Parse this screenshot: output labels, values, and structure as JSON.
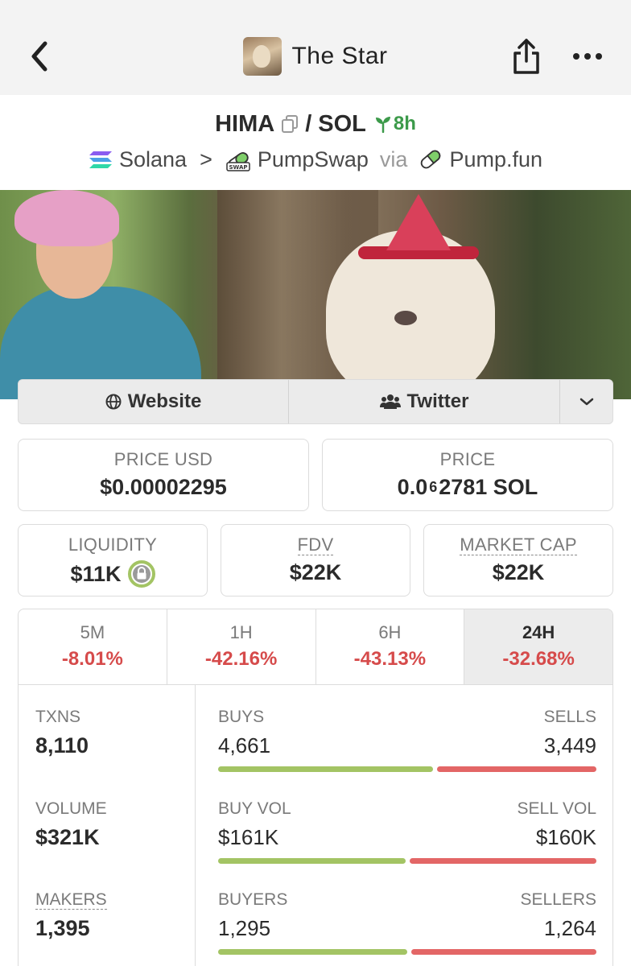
{
  "nav": {
    "title": "The Star",
    "icons": [
      "chevron-left-icon",
      "share-icon",
      "more-icon"
    ]
  },
  "pair": {
    "base": "HIMA",
    "separator": "/",
    "quote": "SOL",
    "age": "8h"
  },
  "route": {
    "chain": "Solana",
    "arrow": ">",
    "dex": "PumpSwap",
    "via": "via",
    "launchpad": "Pump.fun"
  },
  "links": {
    "website": "Website",
    "twitter": "Twitter"
  },
  "prices": {
    "usd_label": "PRICE USD",
    "usd_value": "$0.00002295",
    "native_label": "PRICE",
    "native_prefix": "0.0",
    "native_zeros": "6",
    "native_digits": "2781 SOL"
  },
  "metrics": {
    "liquidity_label": "LIQUIDITY",
    "liquidity_value": "$11K",
    "fdv_label": "FDV",
    "fdv_value": "$22K",
    "mcap_label": "MARKET CAP",
    "mcap_value": "$22K"
  },
  "timeframes": [
    {
      "label": "5M",
      "change": "-8.01%"
    },
    {
      "label": "1H",
      "change": "-42.16%"
    },
    {
      "label": "6H",
      "change": "-43.13%"
    },
    {
      "label": "24H",
      "change": "-32.68%",
      "active": true
    }
  ],
  "stats": {
    "txns_label": "TXNS",
    "txns_value": "8,110",
    "volume_label": "VOLUME",
    "volume_value": "$321K",
    "makers_label": "MAKERS",
    "makers_value": "1,395",
    "buys_label": "BUYS",
    "buys_value": "4,661",
    "sells_label": "SELLS",
    "sells_value": "3,449",
    "buy_vol_label": "BUY VOL",
    "buy_vol_value": "$161K",
    "sell_vol_label": "SELL VOL",
    "sell_vol_value": "$160K",
    "buyers_label": "BUYERS",
    "buyers_value": "1,295",
    "sellers_label": "SELLERS",
    "sellers_value": "1,264"
  },
  "bars": {
    "buys_fraction": 0.575,
    "buy_vol_fraction": 0.5,
    "buyers_fraction": 0.506
  },
  "colors": {
    "positive": "#a3c464",
    "negative": "#e36666",
    "age": "#3c9a4a"
  }
}
